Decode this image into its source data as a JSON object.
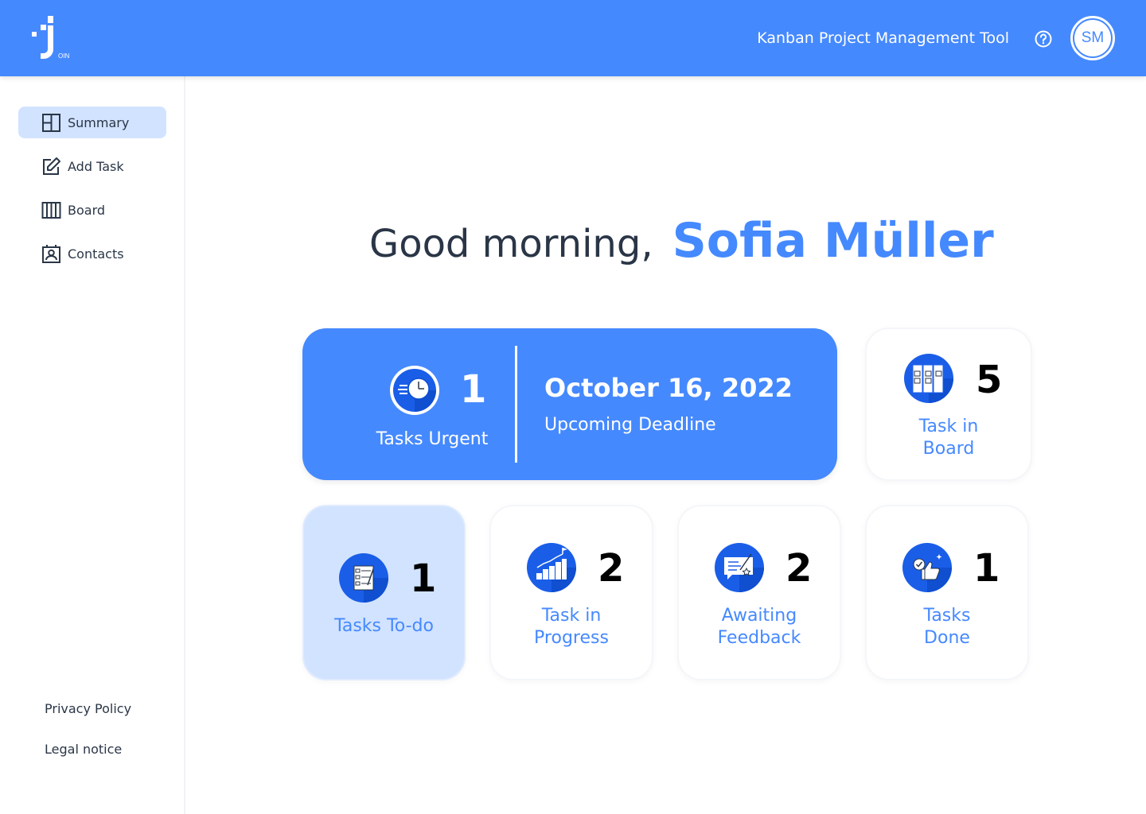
{
  "header": {
    "title": "Kanban Project Management Tool",
    "logo_text": "OIN",
    "avatar_initials": "SM"
  },
  "sidebar": {
    "items": [
      {
        "label": "Summary",
        "icon": "summary-icon",
        "active": true
      },
      {
        "label": "Add Task",
        "icon": "edit-icon",
        "active": false
      },
      {
        "label": "Board",
        "icon": "board-icon",
        "active": false
      },
      {
        "label": "Contacts",
        "icon": "contacts-icon",
        "active": false
      }
    ],
    "footer": [
      "Privacy Policy",
      "Legal notice"
    ]
  },
  "greeting": {
    "text": "Good morning,",
    "name": "Sofia Müller"
  },
  "urgent": {
    "count": "1",
    "label": "Tasks Urgent",
    "deadline_date": "October 16, 2022",
    "deadline_label": "Upcoming Deadline"
  },
  "board": {
    "count": "5",
    "label_line1": "Task in",
    "label_line2": "Board"
  },
  "stats": [
    {
      "count": "1",
      "line1": "Tasks To-do",
      "line2": ""
    },
    {
      "count": "2",
      "line1": "Task in",
      "line2": "Progress"
    },
    {
      "count": "2",
      "line1": "Awaiting",
      "line2": "Feedback"
    },
    {
      "count": "1",
      "line1": "Tasks",
      "line2": "Done"
    }
  ],
  "colors": {
    "primary": "#4589ff",
    "dark": "#2a3647",
    "highlight": "#d2e3ff",
    "icon_blue": "#1a5ee8"
  }
}
